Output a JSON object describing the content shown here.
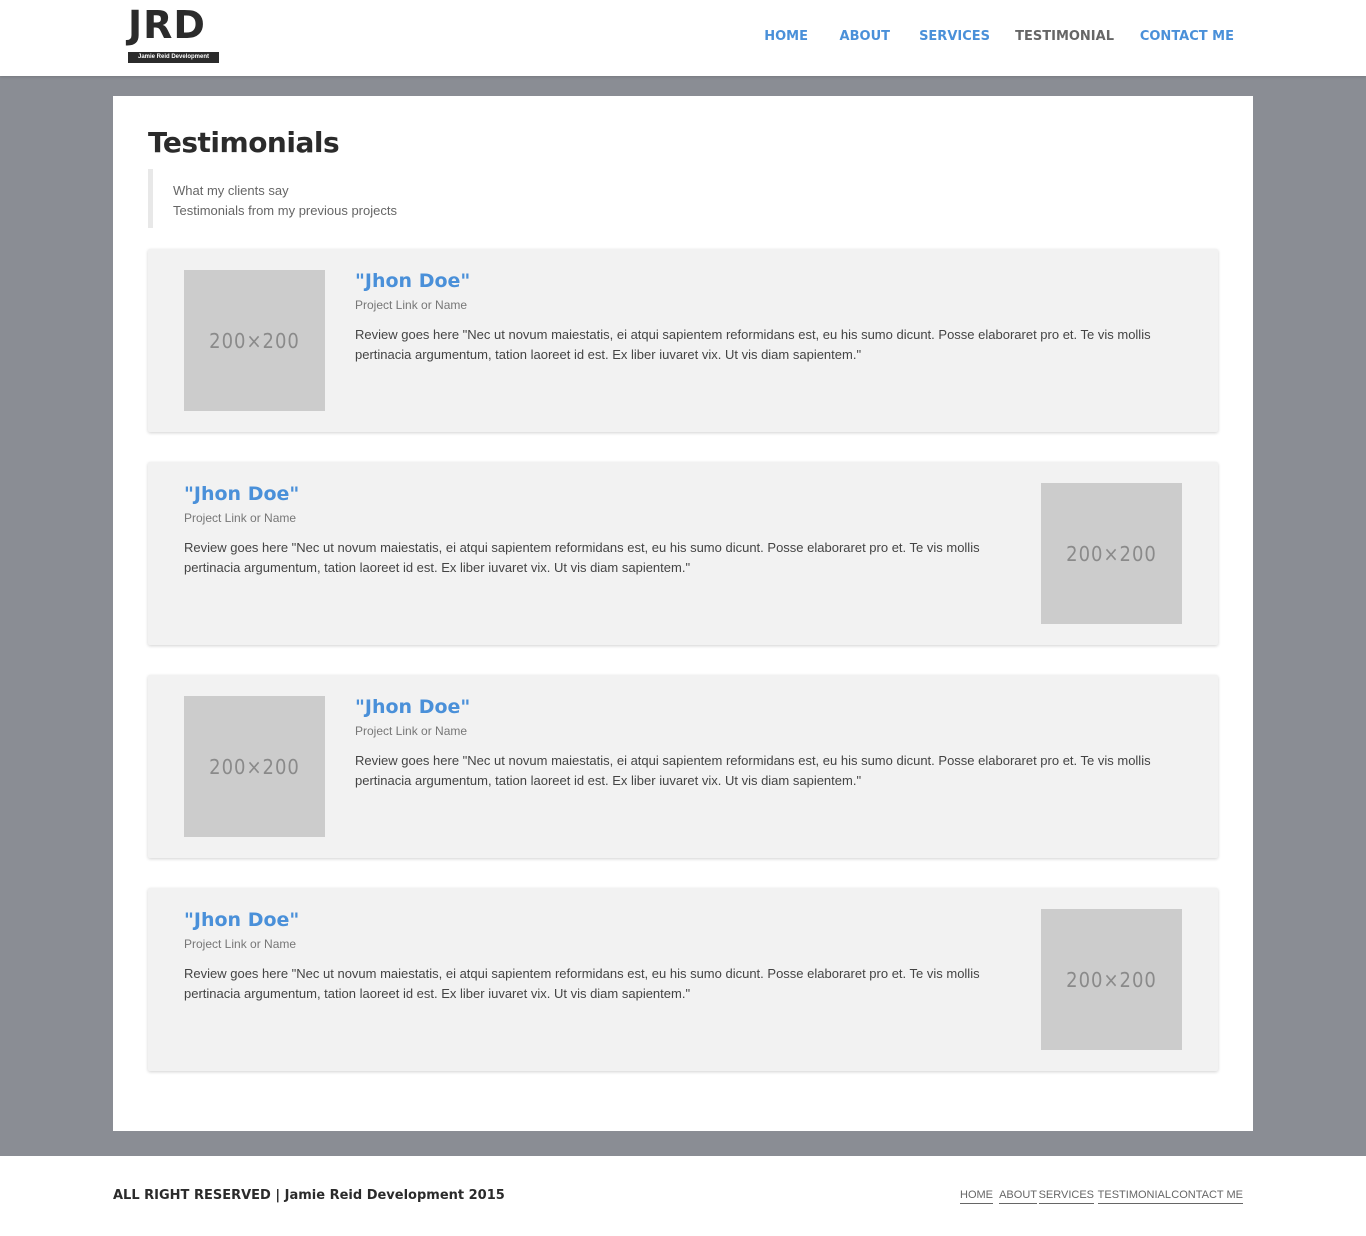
{
  "header": {
    "logo_text": "JRD",
    "logo_subtext": "Jamie Reid Development",
    "nav": [
      {
        "label": "HOME",
        "active": false
      },
      {
        "label": "ABOUT",
        "active": false
      },
      {
        "label": "SERVICES",
        "active": false
      },
      {
        "label": "TESTIMONIAL",
        "active": true
      },
      {
        "label": "CONTACT ME",
        "active": false
      }
    ]
  },
  "main": {
    "title": "Testimonials",
    "subtitle_line1": "What my clients say",
    "subtitle_line2": "Testimonials from my previous projects",
    "testimonials": [
      {
        "name": "\"Jhon Doe\"",
        "project": "Project Link or Name",
        "image_label": "200×200",
        "review": "Review goes here \"Nec ut novum maiestatis, ei atqui sapientem reformidans est, eu his sumo dicunt. Posse elaboraret pro et. Te vis mollis pertinacia argumentum, tation laoreet id est. Ex liber iuvaret vix. Ut vis diam sapientem.\""
      },
      {
        "name": "\"Jhon Doe\"",
        "project": "Project Link or Name",
        "image_label": "200×200",
        "review": "Review goes here \"Nec ut novum maiestatis, ei atqui sapientem reformidans est, eu his sumo dicunt. Posse elaboraret pro et. Te vis mollis pertinacia argumentum, tation laoreet id est. Ex liber iuvaret vix. Ut vis diam sapientem.\""
      },
      {
        "name": "\"Jhon Doe\"",
        "project": "Project Link or Name",
        "image_label": "200×200",
        "review": "Review goes here \"Nec ut novum maiestatis, ei atqui sapientem reformidans est, eu his sumo dicunt. Posse elaboraret pro et. Te vis mollis pertinacia argumentum, tation laoreet id est. Ex liber iuvaret vix. Ut vis diam sapientem.\""
      },
      {
        "name": "\"Jhon Doe\"",
        "project": "Project Link or Name",
        "image_label": "200×200",
        "review": "Review goes here \"Nec ut novum maiestatis, ei atqui sapientem reformidans est, eu his sumo dicunt. Posse elaboraret pro et. Te vis mollis pertinacia argumentum, tation laoreet id est. Ex liber iuvaret vix. Ut vis diam sapientem.\""
      }
    ]
  },
  "footer": {
    "copyright": "ALL RIGHT RESERVED | Jamie Reid Development 2015",
    "nav": [
      "HOME",
      "ABOUT",
      "SERVICES",
      "TESTIMONIAL",
      "CONTACT ME"
    ]
  },
  "colors": {
    "accent": "#4a90d9",
    "band": "#8a8d94",
    "card": "#f2f2f2",
    "placeholder": "#cccccc"
  }
}
